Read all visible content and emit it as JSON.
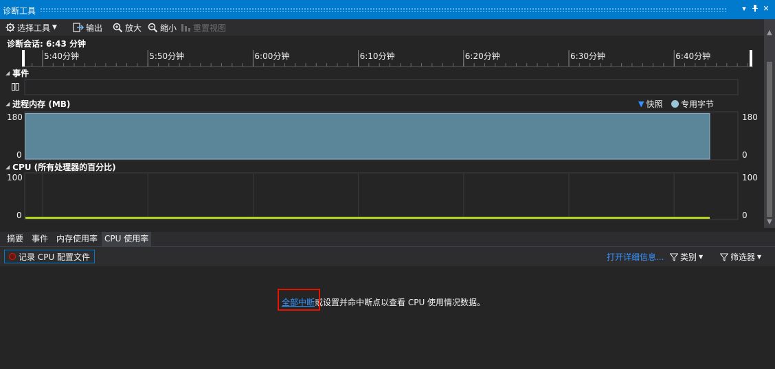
{
  "window": {
    "title": "诊断工具",
    "dropdown_icon": "chevron-down-icon",
    "pin_icon": "pin-icon",
    "close_icon": "close-icon"
  },
  "toolbar": {
    "select_tool": "选择工具",
    "export": "输出",
    "zoom_in": "放大",
    "zoom_out": "缩小",
    "reset_view": "重置视图"
  },
  "session": {
    "label": "诊断会话: 6:43 分钟"
  },
  "timeline": {
    "ticks": [
      "5:40分钟",
      "5:50分钟",
      "6:00分钟",
      "6:10分钟",
      "6:20分钟",
      "6:30分钟",
      "6:40分钟"
    ]
  },
  "events": {
    "title": "事件"
  },
  "memory": {
    "title": "进程内存 (MB)",
    "legend": [
      "快照",
      "专用字节"
    ],
    "y_max": "180",
    "y_min": "0",
    "level_fraction": 0.98
  },
  "cpu": {
    "title": "CPU (所有处理器的百分比)",
    "y_max": "100",
    "y_min": "0",
    "level_percent": 1.5
  },
  "tabs": [
    "摘要",
    "事件",
    "内存使用率",
    "CPU 使用率"
  ],
  "active_tab": "CPU 使用率",
  "subbar": {
    "record_label": "记录 CPU 配置文件",
    "open_details": "打开详细信息...",
    "category": "类别",
    "filter": "筛选器"
  },
  "message": {
    "link": "全部中断",
    "text": "或设置并命中断点以查看 CPU 使用情况数据。"
  },
  "colors": {
    "accent": "#007acc",
    "memory_fill": "#5b8599",
    "cpu_line": "#b4d91c",
    "link": "#3794ff",
    "highlight": "#e51400"
  }
}
